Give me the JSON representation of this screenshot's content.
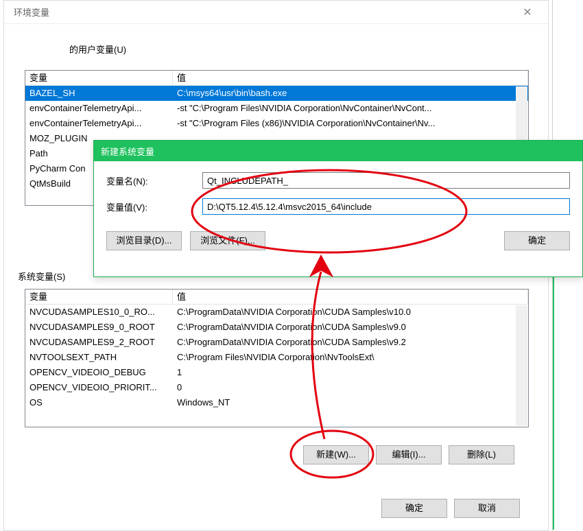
{
  "window": {
    "title": "环境变量",
    "close_glyph": "✕"
  },
  "user_vars": {
    "section_label": "的用户变量(U)",
    "columns": {
      "name": "变量",
      "value": "值"
    },
    "rows": [
      {
        "name": "BAZEL_SH",
        "value": "C:\\msys64\\usr\\bin\\bash.exe"
      },
      {
        "name": "envContainerTelemetryApi...",
        "value": "-st \"C:\\Program Files\\NVIDIA Corporation\\NvContainer\\NvCont..."
      },
      {
        "name": "envContainerTelemetryApi...",
        "value": "-st \"C:\\Program Files (x86)\\NVIDIA Corporation\\NvContainer\\Nv..."
      },
      {
        "name": "MOZ_PLUGIN",
        "value": ""
      },
      {
        "name": "Path",
        "value": ""
      },
      {
        "name": "PyCharm Con",
        "value": ""
      },
      {
        "name": "QtMsBuild",
        "value": ""
      }
    ]
  },
  "system_vars": {
    "section_label": "系统变量(S)",
    "columns": {
      "name": "变量",
      "value": "值"
    },
    "rows": [
      {
        "name": "NVCUDASAMPLES10_0_RO...",
        "value": "C:\\ProgramData\\NVIDIA Corporation\\CUDA Samples\\v10.0"
      },
      {
        "name": "NVCUDASAMPLES9_0_ROOT",
        "value": "C:\\ProgramData\\NVIDIA Corporation\\CUDA Samples\\v9.0"
      },
      {
        "name": "NVCUDASAMPLES9_2_ROOT",
        "value": "C:\\ProgramData\\NVIDIA Corporation\\CUDA Samples\\v9.2"
      },
      {
        "name": "NVTOOLSEXT_PATH",
        "value": "C:\\Program Files\\NVIDIA Corporation\\NvToolsExt\\"
      },
      {
        "name": "OPENCV_VIDEOIO_DEBUG",
        "value": "1"
      },
      {
        "name": "OPENCV_VIDEOIO_PRIORIT...",
        "value": "0"
      },
      {
        "name": "OS",
        "value": "Windows_NT"
      }
    ],
    "buttons": {
      "new": "新建(W)...",
      "edit": "编辑(I)...",
      "delete": "删除(L)"
    }
  },
  "footer": {
    "ok": "确定",
    "cancel": "取消"
  },
  "modal": {
    "title": "新建系统变量",
    "name_label": "变量名(N):",
    "name_value": "Qt_INCLUDEPATH_",
    "value_label": "变量值(V):",
    "value_value": "D:\\QT5.12.4\\5.12.4\\msvc2015_64\\include",
    "browse_dir": "浏览目录(D)...",
    "browse_file": "浏览文件(F)...",
    "ok": "确定"
  }
}
